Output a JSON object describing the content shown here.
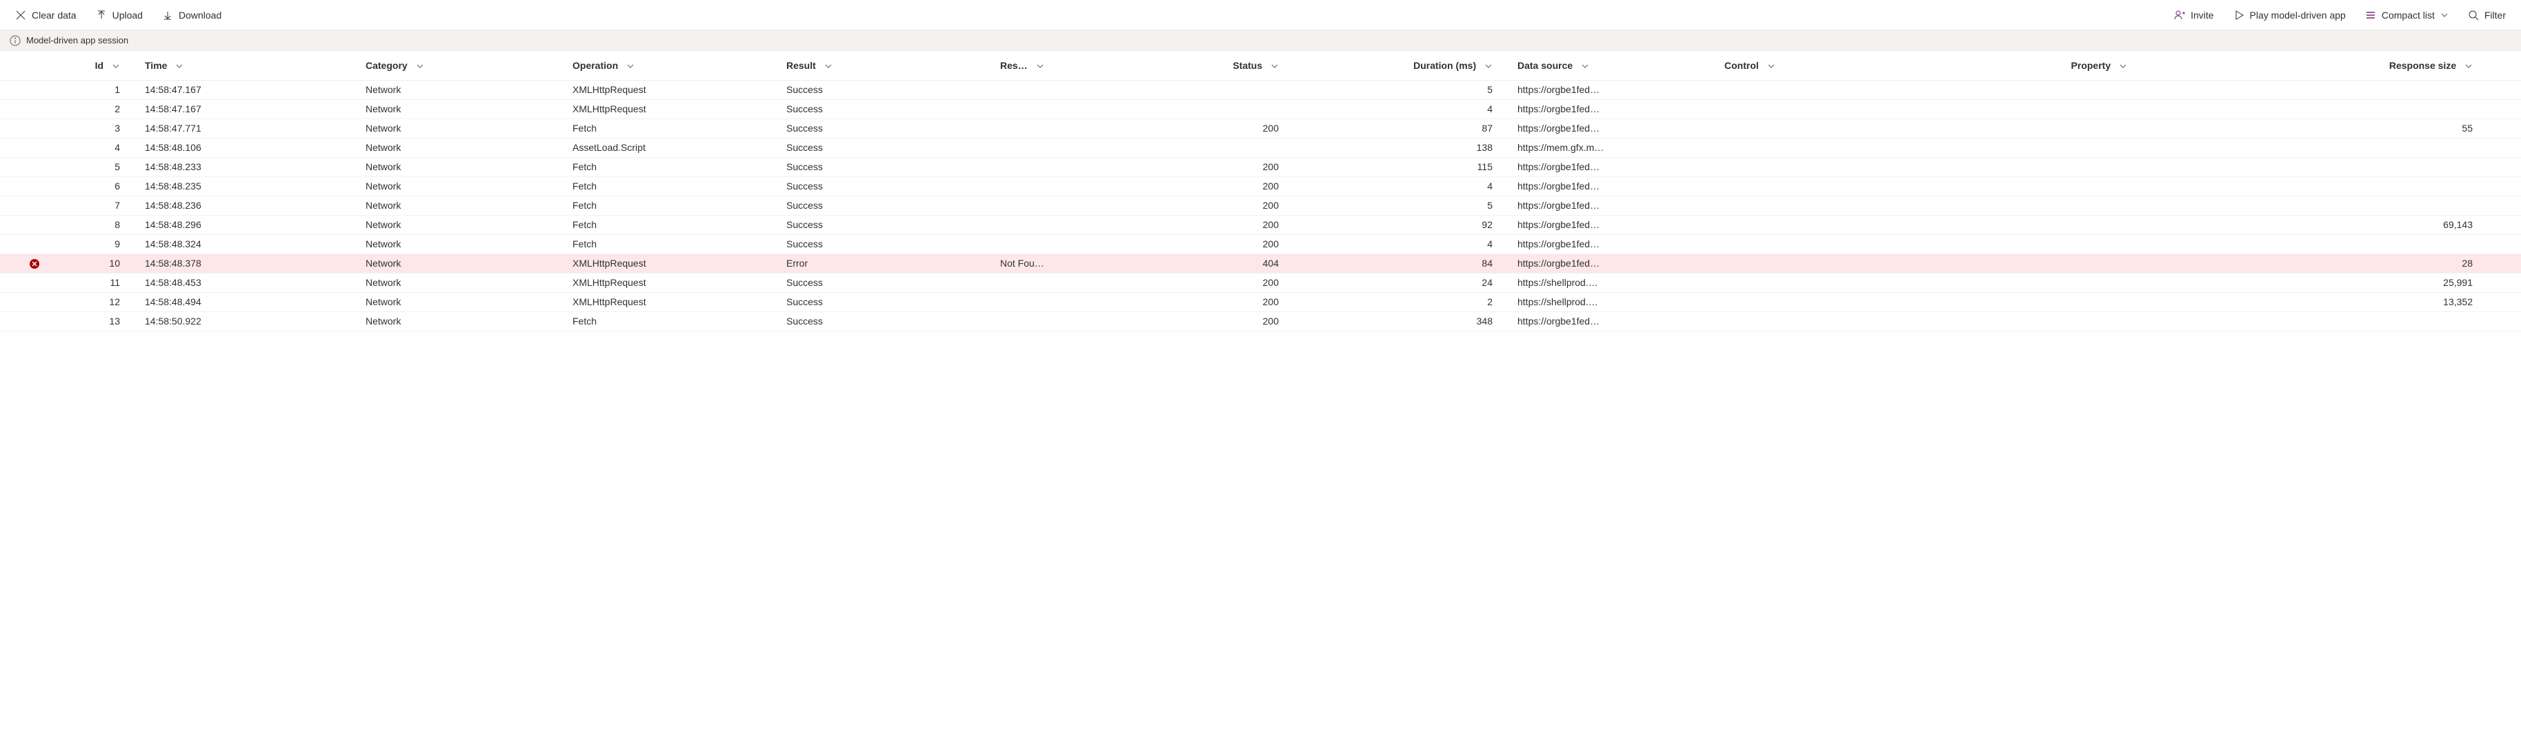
{
  "toolbar": {
    "clear_data_label": "Clear data",
    "upload_label": "Upload",
    "download_label": "Download",
    "invite_label": "Invite",
    "play_label": "Play model-driven app",
    "compact_list_label": "Compact list",
    "filter_label": "Filter"
  },
  "infobar": {
    "session_label": "Model-driven app session"
  },
  "columns": {
    "id": "Id",
    "time": "Time",
    "category": "Category",
    "operation": "Operation",
    "result": "Result",
    "result_info": "Res…",
    "http_status": "Status",
    "duration": "Duration (ms)",
    "data_source": "Data source",
    "control": "Control",
    "property": "Property",
    "response_size": "Response size"
  },
  "rows": [
    {
      "id": "1",
      "time": "14:58:47.167",
      "category": "Network",
      "operation": "XMLHttpRequest",
      "result": "Success",
      "result_info": "",
      "http_status": "",
      "duration": "5",
      "data_source": "https://orgbe1fed…",
      "control": "",
      "property": "",
      "response_size": "",
      "error": false
    },
    {
      "id": "2",
      "time": "14:58:47.167",
      "category": "Network",
      "operation": "XMLHttpRequest",
      "result": "Success",
      "result_info": "",
      "http_status": "",
      "duration": "4",
      "data_source": "https://orgbe1fed…",
      "control": "",
      "property": "",
      "response_size": "",
      "error": false
    },
    {
      "id": "3",
      "time": "14:58:47.771",
      "category": "Network",
      "operation": "Fetch",
      "result": "Success",
      "result_info": "",
      "http_status": "200",
      "duration": "87",
      "data_source": "https://orgbe1fed…",
      "control": "",
      "property": "",
      "response_size": "55",
      "error": false
    },
    {
      "id": "4",
      "time": "14:58:48.106",
      "category": "Network",
      "operation": "AssetLoad.Script",
      "result": "Success",
      "result_info": "",
      "http_status": "",
      "duration": "138",
      "data_source": "https://mem.gfx.m…",
      "control": "",
      "property": "",
      "response_size": "",
      "error": false
    },
    {
      "id": "5",
      "time": "14:58:48.233",
      "category": "Network",
      "operation": "Fetch",
      "result": "Success",
      "result_info": "",
      "http_status": "200",
      "duration": "115",
      "data_source": "https://orgbe1fed…",
      "control": "",
      "property": "",
      "response_size": "",
      "error": false
    },
    {
      "id": "6",
      "time": "14:58:48.235",
      "category": "Network",
      "operation": "Fetch",
      "result": "Success",
      "result_info": "",
      "http_status": "200",
      "duration": "4",
      "data_source": "https://orgbe1fed…",
      "control": "",
      "property": "",
      "response_size": "",
      "error": false
    },
    {
      "id": "7",
      "time": "14:58:48.236",
      "category": "Network",
      "operation": "Fetch",
      "result": "Success",
      "result_info": "",
      "http_status": "200",
      "duration": "5",
      "data_source": "https://orgbe1fed…",
      "control": "",
      "property": "",
      "response_size": "",
      "error": false
    },
    {
      "id": "8",
      "time": "14:58:48.296",
      "category": "Network",
      "operation": "Fetch",
      "result": "Success",
      "result_info": "",
      "http_status": "200",
      "duration": "92",
      "data_source": "https://orgbe1fed…",
      "control": "",
      "property": "",
      "response_size": "69,143",
      "error": false
    },
    {
      "id": "9",
      "time": "14:58:48.324",
      "category": "Network",
      "operation": "Fetch",
      "result": "Success",
      "result_info": "",
      "http_status": "200",
      "duration": "4",
      "data_source": "https://orgbe1fed…",
      "control": "",
      "property": "",
      "response_size": "",
      "error": false
    },
    {
      "id": "10",
      "time": "14:58:48.378",
      "category": "Network",
      "operation": "XMLHttpRequest",
      "result": "Error",
      "result_info": "Not Fou…",
      "http_status": "404",
      "duration": "84",
      "data_source": "https://orgbe1fed…",
      "control": "",
      "property": "",
      "response_size": "28",
      "error": true
    },
    {
      "id": "11",
      "time": "14:58:48.453",
      "category": "Network",
      "operation": "XMLHttpRequest",
      "result": "Success",
      "result_info": "",
      "http_status": "200",
      "duration": "24",
      "data_source": "https://shellprod.…",
      "control": "",
      "property": "",
      "response_size": "25,991",
      "error": false
    },
    {
      "id": "12",
      "time": "14:58:48.494",
      "category": "Network",
      "operation": "XMLHttpRequest",
      "result": "Success",
      "result_info": "",
      "http_status": "200",
      "duration": "2",
      "data_source": "https://shellprod.…",
      "control": "",
      "property": "",
      "response_size": "13,352",
      "error": false
    },
    {
      "id": "13",
      "time": "14:58:50.922",
      "category": "Network",
      "operation": "Fetch",
      "result": "Success",
      "result_info": "",
      "http_status": "200",
      "duration": "348",
      "data_source": "https://orgbe1fed…",
      "control": "",
      "property": "",
      "response_size": "",
      "error": false
    }
  ]
}
